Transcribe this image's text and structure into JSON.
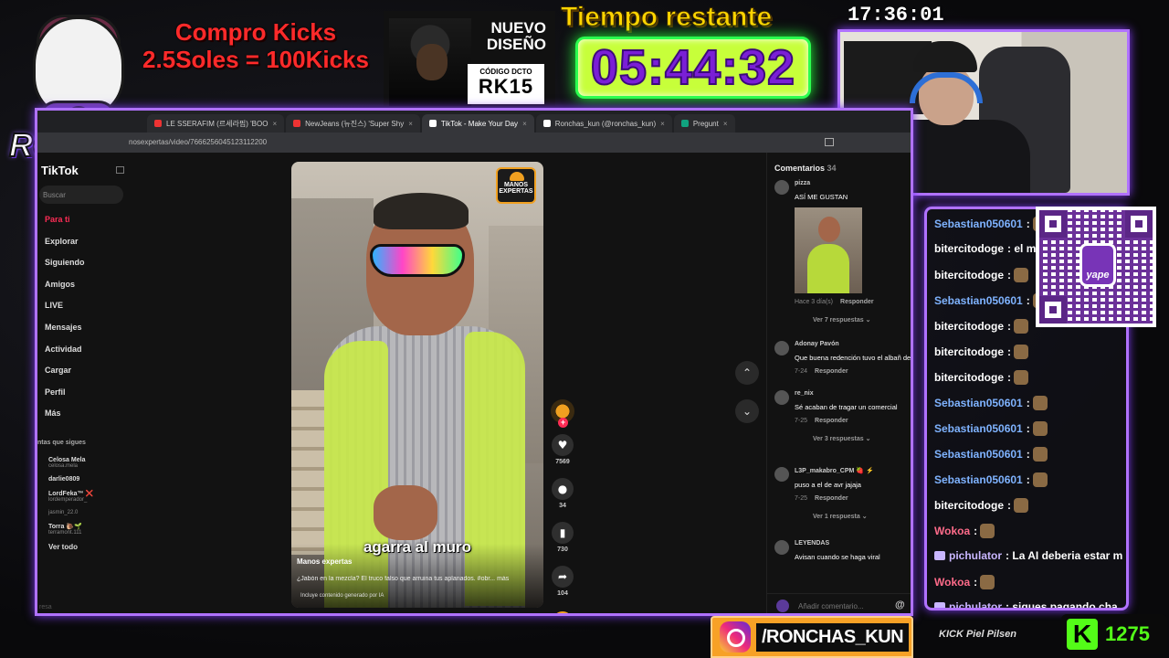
{
  "overlay": {
    "logo_text": "RONCHAS",
    "kicks_line1": "Compro Kicks",
    "kicks_line2": "2.5Soles = 100Kicks",
    "ad_line1": "NUEVO",
    "ad_line2": "DISEÑO",
    "ad_code_label": "CÓDIGO DCTO",
    "ad_code": "RK15",
    "timer_label": "Tiempo restante",
    "timer_value": "05:44:32",
    "clock": "17:36:01",
    "instagram": "/RONCHAS_KUN",
    "sponsors": "KICK  Piel  Pilsen",
    "kick_count": "1275",
    "kick_letter": "K",
    "colors": {
      "frame": "#b072ff",
      "timer_text": "#7a1fd6",
      "kick_green": "#53fc18",
      "red": "#ff2a2a"
    }
  },
  "browser": {
    "tabs": [
      {
        "label": "LE SSERAFIM (르세라핌) 'BOO",
        "icon": "youtube-icon"
      },
      {
        "label": "NewJeans (뉴진스) 'Super Shy",
        "icon": "youtube-icon"
      },
      {
        "label": "TikTok - Make Your Day",
        "icon": "tiktok-icon",
        "active": true
      },
      {
        "label": "Ronchas_kun (@ronchas_kun)",
        "icon": "tiktok-icon"
      },
      {
        "label": "Pregunt",
        "icon": "chatgpt-icon"
      }
    ],
    "url": "nosexpertas/video/7666256045123112200"
  },
  "tiktok": {
    "brand": "TikTok",
    "search_placeholder": "Buscar",
    "nav": [
      "Para ti",
      "Explorar",
      "Siguiendo",
      "Amigos",
      "LIVE",
      "Mensajes",
      "Actividad",
      "Cargar",
      "Perfil",
      "Más"
    ],
    "follows_header": "ntas que sigues",
    "follows": [
      {
        "name": "Celosa Mela",
        "user": "celosa.mela"
      },
      {
        "name": "darlie0809",
        "user": ""
      },
      {
        "name": "LordFeka™ ❌",
        "user": "lordemperador_"
      },
      {
        "name": "",
        "user": "jasmin_22.0"
      },
      {
        "name": "Torra 🐌🌱",
        "user": "terramont.111"
      }
    ],
    "see_all": "Ver todo",
    "footer": "resa",
    "video": {
      "badge": "MANOS EXPERTAS",
      "caption": "agarra al muro",
      "author": "Manos expertas",
      "description": "¿Jabón en la mezcla? El truco falso que arruina tus aplanados. #obr...  más",
      "ai_label": "Incluye contenido generado por IA"
    },
    "actions": [
      {
        "icon": "heart-icon",
        "glyph": "♥",
        "count": "7569"
      },
      {
        "icon": "comment-icon",
        "glyph": "●",
        "count": "34"
      },
      {
        "icon": "bookmark-icon",
        "glyph": "▮",
        "count": "730"
      },
      {
        "icon": "share-icon",
        "glyph": "➦",
        "count": "104"
      }
    ],
    "nav_up": "⌃",
    "nav_down": "⌄",
    "comments_header": "Comentarios",
    "comments_count": "34",
    "comments": [
      {
        "user": "pizza",
        "text": "ASÍ ME GUSTAN",
        "meta": "Hace 3 día(s)",
        "reply": "Responder",
        "more": "Ver 7 respuestas ⌄",
        "thumb": true
      },
      {
        "user": "Adonay Pavón",
        "text": "Que buena redención tuvo el albañ desarrollo de personaje",
        "meta": "7-24",
        "reply": "Responder",
        "more": ""
      },
      {
        "user": "re_nix",
        "text": "Sé acaban de tragar un comercial",
        "meta": "7-25",
        "reply": "Responder",
        "more": "Ver 3 respuestas ⌄"
      },
      {
        "user": "L3P_makabro_CPM 🍓 ⚡",
        "text": "puso a el de avr jajaja",
        "meta": "7-25",
        "reply": "Responder",
        "more": "Ver 1 respuesta ⌄"
      },
      {
        "user": "LEYENDAS",
        "text": "Avisan cuando se haga viral",
        "meta": "",
        "reply": "",
        "more": ""
      }
    ],
    "comment_placeholder": "Añadir comentario...",
    "comment_at": "@"
  },
  "chat": [
    {
      "user": "Sebastian050601",
      "color": "#7fb3ff",
      "msg": "",
      "emote": true,
      "badge": false
    },
    {
      "user": "bitercitodoge",
      "color": "#ffffff",
      "msg": "el m",
      "emote": false,
      "badge": false
    },
    {
      "user": "bitercitodoge",
      "color": "#ffffff",
      "msg": "",
      "emote": true,
      "badge": false
    },
    {
      "user": "Sebastian050601",
      "color": "#7fb3ff",
      "msg": "",
      "emote": true,
      "badge": false
    },
    {
      "user": "bitercitodoge",
      "color": "#ffffff",
      "msg": "",
      "emote": true,
      "badge": false
    },
    {
      "user": "bitercitodoge",
      "color": "#ffffff",
      "msg": "",
      "emote": true,
      "badge": false
    },
    {
      "user": "bitercitodoge",
      "color": "#ffffff",
      "msg": "",
      "emote": true,
      "badge": false
    },
    {
      "user": "Sebastian050601",
      "color": "#7fb3ff",
      "msg": "",
      "emote": true,
      "badge": false
    },
    {
      "user": "Sebastian050601",
      "color": "#7fb3ff",
      "msg": "",
      "emote": true,
      "badge": false
    },
    {
      "user": "Sebastian050601",
      "color": "#7fb3ff",
      "msg": "",
      "emote": true,
      "badge": false
    },
    {
      "user": "Sebastian050601",
      "color": "#7fb3ff",
      "msg": "",
      "emote": true,
      "badge": false
    },
    {
      "user": "bitercitodoge",
      "color": "#ffffff",
      "msg": "",
      "emote": true,
      "badge": false
    },
    {
      "user": "Wokoa",
      "color": "#ff6b8a",
      "msg": "",
      "emote": true,
      "badge": false
    },
    {
      "user": "pichulator",
      "color": "#c9b6ff",
      "msg": "La AI deberia estar m",
      "emote": false,
      "badge": true
    },
    {
      "user": "Wokoa",
      "color": "#ff6b8a",
      "msg": "",
      "emote": true,
      "badge": false
    },
    {
      "user": "pichulator",
      "color": "#c9b6ff",
      "msg": "sigues pagando cha",
      "emote": false,
      "badge": true
    }
  ],
  "qr": {
    "label": "yape"
  }
}
